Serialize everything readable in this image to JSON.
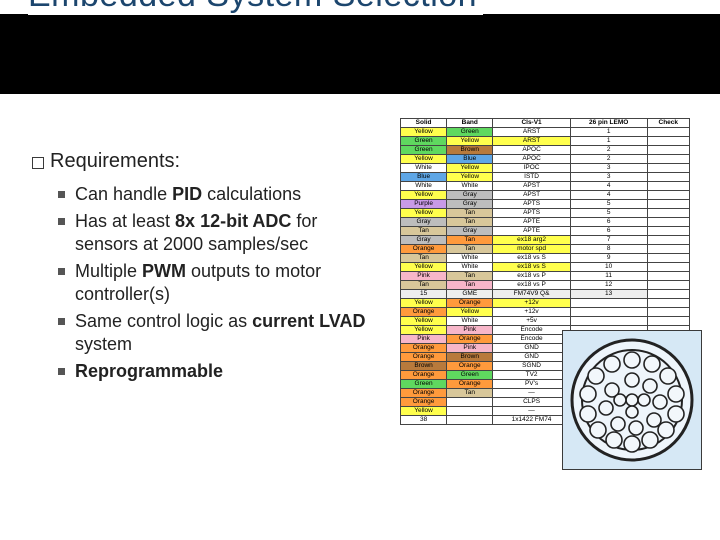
{
  "title": "Embedded System Selection",
  "heading": "Requirements:",
  "bullets": [
    {
      "pre": "Can handle ",
      "bold": "PID",
      "post": " calculations"
    },
    {
      "pre": "Has at least ",
      "bold": "8x 12-bit ADC",
      "post": " for sensors at 2000 samples/sec"
    },
    {
      "pre": "Multiple ",
      "bold": "PWM",
      "post": " outputs to motor controller(s)"
    },
    {
      "pre": "Same control logic as ",
      "bold": "current LVAD",
      "post": " system"
    },
    {
      "pre": "",
      "bold": "Reprogrammable",
      "post": ""
    }
  ],
  "table": {
    "headers": [
      "Solid",
      "Band",
      "Cls-V1",
      "26 pin LEMO",
      "Check"
    ],
    "rows": [
      {
        "cls": [
          "c-yellow",
          "c-green",
          "",
          ""
        ],
        "cells": [
          "Yellow",
          "Green",
          "ARST",
          "1",
          ""
        ]
      },
      {
        "cls": [
          "c-green",
          "c-yellow",
          "c-yellow",
          ""
        ],
        "cells": [
          "Green",
          "Yellow",
          "ARST",
          "1",
          ""
        ]
      },
      {
        "cls": [
          "c-green",
          "c-brown",
          "",
          ""
        ],
        "cells": [
          "Green",
          "Brown",
          "APOC",
          "2",
          ""
        ]
      },
      {
        "cls": [
          "c-yellow",
          "c-blue",
          "",
          ""
        ],
        "cells": [
          "Yellow",
          "Blue",
          "APOC",
          "2",
          ""
        ]
      },
      {
        "cls": [
          "c-white",
          "c-yellow",
          "",
          ""
        ],
        "cells": [
          "White",
          "Yellow",
          "IPOC",
          "3",
          ""
        ]
      },
      {
        "cls": [
          "c-blue",
          "c-yellow",
          "",
          ""
        ],
        "cells": [
          "Blue",
          "Yellow",
          "ISTD",
          "3",
          ""
        ]
      },
      {
        "cls": [
          "c-white",
          "c-white",
          "",
          ""
        ],
        "cells": [
          "White",
          "White",
          "APST",
          "4",
          ""
        ]
      },
      {
        "cls": [
          "c-yellow",
          "c-gray",
          "",
          ""
        ],
        "cells": [
          "Yellow",
          "Gray",
          "APST",
          "4",
          ""
        ]
      },
      {
        "cls": [
          "c-purple",
          "c-gray",
          "",
          ""
        ],
        "cells": [
          "Purple",
          "Gray",
          "APTS",
          "5",
          ""
        ]
      },
      {
        "cls": [
          "c-yellow",
          "c-tan",
          "",
          ""
        ],
        "cells": [
          "Yellow",
          "Tan",
          "APTS",
          "5",
          ""
        ]
      },
      {
        "cls": [
          "c-gray",
          "c-tan",
          "",
          ""
        ],
        "cells": [
          "Gray",
          "Tan",
          "APTE",
          "6",
          ""
        ]
      },
      {
        "cls": [
          "c-tan",
          "c-gray",
          "",
          ""
        ],
        "cells": [
          "Tan",
          "Gray",
          "APTE",
          "6",
          ""
        ]
      },
      {
        "cls": [
          "c-gray",
          "c-orange",
          "c-yellow",
          ""
        ],
        "cells": [
          "Gray",
          "Tan",
          "ex18 arg2",
          "7",
          ""
        ]
      },
      {
        "cls": [
          "c-orange",
          "c-tan",
          "c-yellow",
          ""
        ],
        "cells": [
          "Orange",
          "Tan",
          "motor spd",
          "8",
          ""
        ]
      },
      {
        "cls": [
          "c-tan",
          "c-white",
          "",
          ""
        ],
        "cells": [
          "Tan",
          "White",
          "ex18 vs S",
          "9",
          ""
        ]
      },
      {
        "cls": [
          "c-yellow",
          "c-white",
          "c-yellow",
          ""
        ],
        "cells": [
          "Yellow",
          "White",
          "ex18 vs S",
          "10",
          ""
        ]
      },
      {
        "cls": [
          "c-pink",
          "c-tan",
          "",
          ""
        ],
        "cells": [
          "Pink",
          "Tan",
          "ex18 vs P",
          "11",
          ""
        ]
      },
      {
        "cls": [
          "c-tan",
          "c-pink",
          "",
          ""
        ],
        "cells": [
          "Tan",
          "Tan",
          "ex18 vs P",
          "12",
          ""
        ]
      },
      {
        "cls": [
          "c-sep",
          "c-sep",
          "c-sep",
          "c-sep"
        ],
        "cells": [
          "15",
          "GME",
          "FM74V9 Q&",
          "13",
          ""
        ]
      },
      {
        "cls": [
          "c-yellow",
          "c-orange",
          "c-yellow",
          ""
        ],
        "cells": [
          "Yellow",
          "Orange",
          "+12v",
          "",
          ""
        ]
      },
      {
        "cls": [
          "c-orange",
          "c-yellow",
          "",
          ""
        ],
        "cells": [
          "Orange",
          "Yellow",
          "+12v",
          "",
          ""
        ]
      },
      {
        "cls": [
          "c-yellow",
          "c-white",
          "",
          ""
        ],
        "cells": [
          "Yellow",
          "White",
          "+5v",
          "",
          ""
        ]
      },
      {
        "cls": [
          "c-yellow",
          "c-pink",
          "",
          ""
        ],
        "cells": [
          "Yellow",
          "Pink",
          "Encode",
          "",
          ""
        ]
      },
      {
        "cls": [
          "c-pink",
          "c-orange",
          "",
          ""
        ],
        "cells": [
          "Pink",
          "Orange",
          "Encode",
          "",
          ""
        ]
      },
      {
        "cls": [
          "c-orange",
          "c-pink",
          "",
          ""
        ],
        "cells": [
          "Orange",
          "Pink",
          "GND",
          "",
          ""
        ]
      },
      {
        "cls": [
          "c-orange",
          "c-brown",
          "",
          ""
        ],
        "cells": [
          "Orange",
          "Brown",
          "GND",
          "",
          ""
        ]
      },
      {
        "cls": [
          "c-brown",
          "c-orange",
          "",
          ""
        ],
        "cells": [
          "Brown",
          "Orange",
          "SGND",
          "",
          ""
        ]
      },
      {
        "cls": [
          "c-orange",
          "c-green",
          "",
          ""
        ],
        "cells": [
          "Orange",
          "Green",
          "TV2",
          "",
          ""
        ]
      },
      {
        "cls": [
          "c-green",
          "c-orange",
          "",
          ""
        ],
        "cells": [
          "Green",
          "Orange",
          "PV's",
          "",
          ""
        ]
      },
      {
        "cls": [
          "c-orange",
          "c-tan",
          "",
          ""
        ],
        "cells": [
          "Orange",
          "Tan",
          "—",
          "",
          ""
        ]
      },
      {
        "cls": [
          "c-orange",
          "",
          "",
          ""
        ],
        "cells": [
          "Orange",
          "",
          "CLPS",
          "",
          ""
        ]
      },
      {
        "cls": [
          "c-yellow",
          "",
          "",
          ""
        ],
        "cells": [
          "Yellow",
          "",
          "—",
          "",
          ""
        ]
      },
      {
        "cls": [
          "",
          "",
          "",
          ""
        ],
        "cells": [
          "38",
          "",
          "1x1422 FM74",
          "",
          ""
        ]
      }
    ]
  },
  "connector": {
    "pin_count": 26
  }
}
